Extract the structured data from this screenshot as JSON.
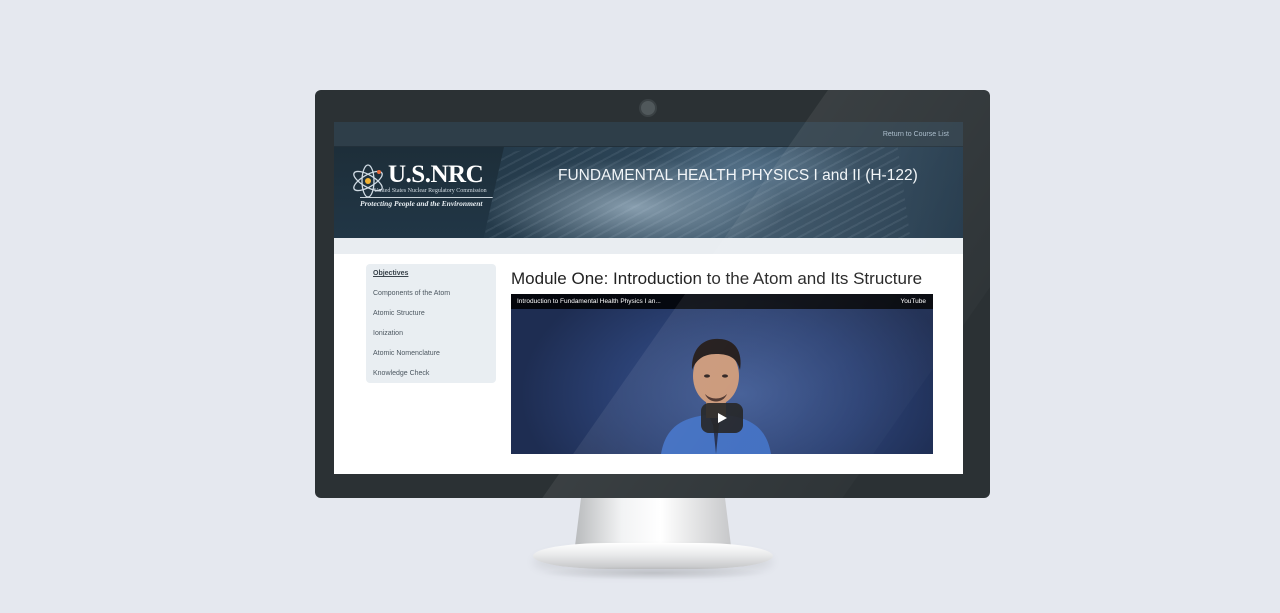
{
  "topbar": {
    "return_link": "Return to Course List"
  },
  "banner": {
    "logo_text": "U.S.NRC",
    "logo_subtitle": "United States Nuclear Regulatory Commission",
    "logo_tagline": "Protecting People and the Environment",
    "course_title": "FUNDAMENTAL HEALTH PHYSICS I and II (H-122)"
  },
  "sidebar": {
    "items": [
      {
        "label": "Objectives",
        "active": true
      },
      {
        "label": "Components of the Atom"
      },
      {
        "label": "Atomic Structure"
      },
      {
        "label": "Ionization"
      },
      {
        "label": "Atomic Nomenclature"
      },
      {
        "label": "Knowledge Check"
      }
    ]
  },
  "main": {
    "title": "Module One: Introduction to the Atom and Its Structure",
    "video": {
      "title": "Introduction to Fundamental Health Physics I an...",
      "provider": "YouTube",
      "play_icon": "play-icon"
    }
  },
  "colors": {
    "page_background": "#e5e8ef",
    "monitor_bezel": "#2b3134",
    "topbar": "#2e3e49",
    "sidebar_bg": "#e9eef2"
  }
}
